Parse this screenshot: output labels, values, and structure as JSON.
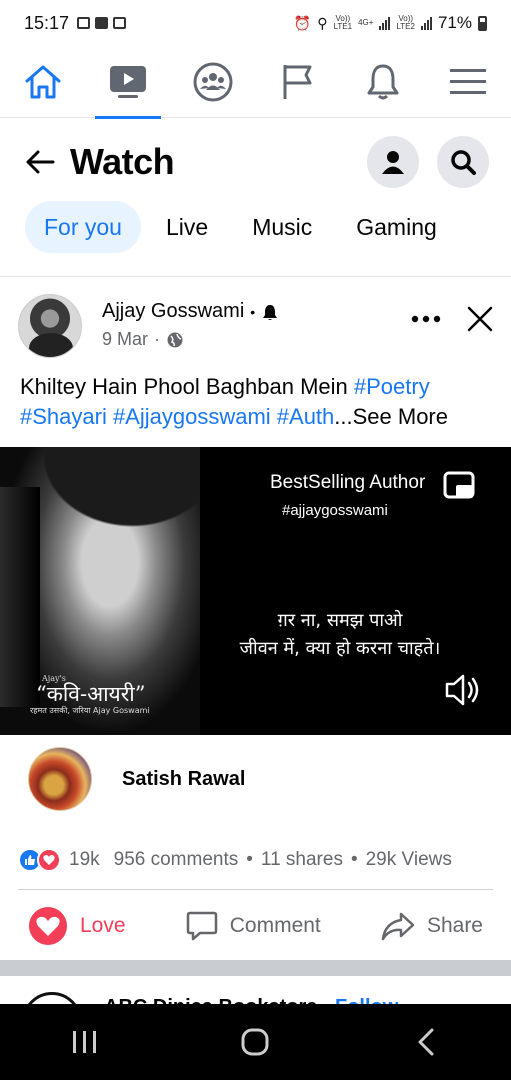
{
  "status_bar": {
    "time": "15:17",
    "net1": "Vo))\nLTE1",
    "net_type": "4G+",
    "net2": "Vo))\nLTE2",
    "battery": "71%"
  },
  "nav": {
    "items": [
      {
        "icon": "home-icon"
      },
      {
        "icon": "watch-icon",
        "active": true
      },
      {
        "icon": "groups-icon"
      },
      {
        "icon": "pages-flag-icon"
      },
      {
        "icon": "notifications-bell-icon"
      },
      {
        "icon": "menu-icon"
      }
    ]
  },
  "header": {
    "title": "Watch"
  },
  "tabs": [
    "For you",
    "Live",
    "Music",
    "Gaming"
  ],
  "post": {
    "author": "Ajjay Gosswami",
    "date": "9 Mar",
    "caption_text": "Khiltey Hain Phool Baghban Mein ",
    "caption_tags": "#Poetry #Shayari #Ajjaygosswami #Auth",
    "see_more": "...See More",
    "video": {
      "overlay_author": "BestSelling Author",
      "overlay_tag": "#ajjaygosswami",
      "hindi_line1": "ग़र ना, समझ पाओ",
      "hindi_line2": "जीवन में, क्या हो करना चाहते।",
      "book_small": "Ajay's",
      "book_title": "“कवि-आयरी”",
      "book_sub": "रहमत उसकी, जरिया Ajay Goswami"
    },
    "commenter": "Satish Rawal",
    "reactions_count": "19k",
    "comments": "956 comments",
    "shares": "11 shares",
    "views": "29k Views",
    "actions": {
      "love": "Love",
      "comment": "Comment",
      "share": "Share"
    }
  },
  "next_post": {
    "author": "ABC Dinica Bookstore",
    "follow": "Follow"
  },
  "colors": {
    "accent": "#1877f2",
    "love": "#f33e58",
    "text": "#050505",
    "muted": "#65676b"
  }
}
